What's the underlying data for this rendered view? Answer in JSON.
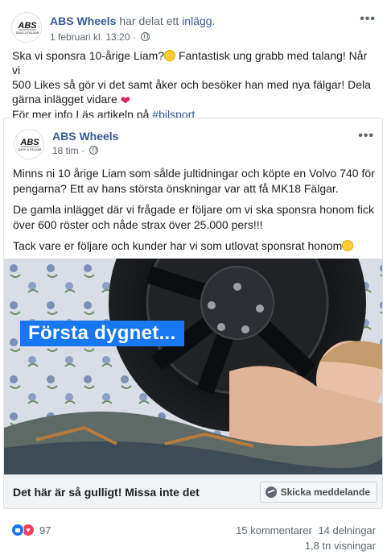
{
  "outer_post": {
    "page_name": "ABS Wheels",
    "action_text": "har delat ett",
    "action_link": "inlägg.",
    "timestamp": "1 februari kl. 13:20",
    "avatar_line1": "ABS",
    "avatar_line2": "DÄCK & FÄLGAR",
    "line1a": "Ska vi sponsra 10-årige Liam?",
    "line1b": " Fantastisk ung grabb med talang! Når vi",
    "line2": "500 Likes så gör vi det samt åker och besöker han med nya fälgar! Dela",
    "line3": "gärna inlägget vidare ",
    "line4a": "För mer info Läs artikeln på ",
    "hashtag": "#bilsport"
  },
  "shared_post": {
    "page_name": "ABS Wheels",
    "timestamp": "18 tim ·",
    "avatar_line1": "ABS",
    "avatar_line2": "DÄCK & FÄLGAR",
    "para1": "Minns ni 10 årige Liam som sålde jultidningar och köpte en Volvo 740 för pengarna? Ett av hans största önskningar var att få MK18 Fälgar.",
    "para2": "De gamla inlägget där vi frågade er följare om vi ska sponsra honom fick över 600 röster och nåde strax över 25.000 pers!!!",
    "para3": "Tack vare er följare och kunder har vi som utlovat sponsrat honom",
    "image_overlay": "Första dygnet...",
    "cta_title": "Det här är så gulligt! Missa inte det",
    "cta_button": "Skicka meddelande"
  },
  "footer": {
    "reaction_count": "97",
    "comments": "15 kommentarer",
    "shares": "14 delningar",
    "views": "1,8 tn visningar"
  },
  "colors": {
    "link": "#385898",
    "brand_blue": "#1877f2",
    "love": "#f33e58"
  },
  "icons": [
    "globe-icon",
    "more-options-icon",
    "messenger-icon",
    "like-reaction-icon",
    "love-reaction-icon"
  ]
}
